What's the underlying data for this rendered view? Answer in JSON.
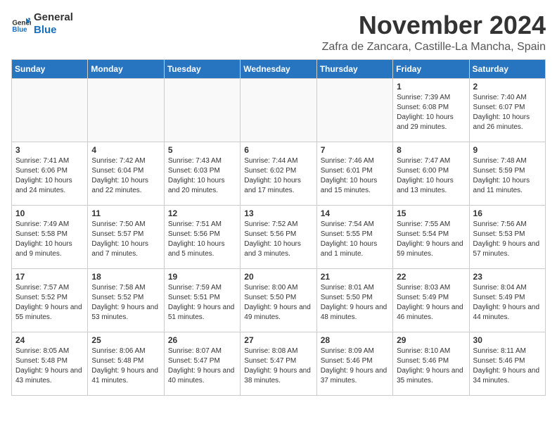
{
  "logo": {
    "line1": "General",
    "line2": "Blue"
  },
  "title": "November 2024",
  "location": "Zafra de Zancara, Castille-La Mancha, Spain",
  "days_of_week": [
    "Sunday",
    "Monday",
    "Tuesday",
    "Wednesday",
    "Thursday",
    "Friday",
    "Saturday"
  ],
  "weeks": [
    [
      {
        "day": "",
        "info": ""
      },
      {
        "day": "",
        "info": ""
      },
      {
        "day": "",
        "info": ""
      },
      {
        "day": "",
        "info": ""
      },
      {
        "day": "",
        "info": ""
      },
      {
        "day": "1",
        "info": "Sunrise: 7:39 AM\nSunset: 6:08 PM\nDaylight: 10 hours and 29 minutes."
      },
      {
        "day": "2",
        "info": "Sunrise: 7:40 AM\nSunset: 6:07 PM\nDaylight: 10 hours and 26 minutes."
      }
    ],
    [
      {
        "day": "3",
        "info": "Sunrise: 7:41 AM\nSunset: 6:06 PM\nDaylight: 10 hours and 24 minutes."
      },
      {
        "day": "4",
        "info": "Sunrise: 7:42 AM\nSunset: 6:04 PM\nDaylight: 10 hours and 22 minutes."
      },
      {
        "day": "5",
        "info": "Sunrise: 7:43 AM\nSunset: 6:03 PM\nDaylight: 10 hours and 20 minutes."
      },
      {
        "day": "6",
        "info": "Sunrise: 7:44 AM\nSunset: 6:02 PM\nDaylight: 10 hours and 17 minutes."
      },
      {
        "day": "7",
        "info": "Sunrise: 7:46 AM\nSunset: 6:01 PM\nDaylight: 10 hours and 15 minutes."
      },
      {
        "day": "8",
        "info": "Sunrise: 7:47 AM\nSunset: 6:00 PM\nDaylight: 10 hours and 13 minutes."
      },
      {
        "day": "9",
        "info": "Sunrise: 7:48 AM\nSunset: 5:59 PM\nDaylight: 10 hours and 11 minutes."
      }
    ],
    [
      {
        "day": "10",
        "info": "Sunrise: 7:49 AM\nSunset: 5:58 PM\nDaylight: 10 hours and 9 minutes."
      },
      {
        "day": "11",
        "info": "Sunrise: 7:50 AM\nSunset: 5:57 PM\nDaylight: 10 hours and 7 minutes."
      },
      {
        "day": "12",
        "info": "Sunrise: 7:51 AM\nSunset: 5:56 PM\nDaylight: 10 hours and 5 minutes."
      },
      {
        "day": "13",
        "info": "Sunrise: 7:52 AM\nSunset: 5:56 PM\nDaylight: 10 hours and 3 minutes."
      },
      {
        "day": "14",
        "info": "Sunrise: 7:54 AM\nSunset: 5:55 PM\nDaylight: 10 hours and 1 minute."
      },
      {
        "day": "15",
        "info": "Sunrise: 7:55 AM\nSunset: 5:54 PM\nDaylight: 9 hours and 59 minutes."
      },
      {
        "day": "16",
        "info": "Sunrise: 7:56 AM\nSunset: 5:53 PM\nDaylight: 9 hours and 57 minutes."
      }
    ],
    [
      {
        "day": "17",
        "info": "Sunrise: 7:57 AM\nSunset: 5:52 PM\nDaylight: 9 hours and 55 minutes."
      },
      {
        "day": "18",
        "info": "Sunrise: 7:58 AM\nSunset: 5:52 PM\nDaylight: 9 hours and 53 minutes."
      },
      {
        "day": "19",
        "info": "Sunrise: 7:59 AM\nSunset: 5:51 PM\nDaylight: 9 hours and 51 minutes."
      },
      {
        "day": "20",
        "info": "Sunrise: 8:00 AM\nSunset: 5:50 PM\nDaylight: 9 hours and 49 minutes."
      },
      {
        "day": "21",
        "info": "Sunrise: 8:01 AM\nSunset: 5:50 PM\nDaylight: 9 hours and 48 minutes."
      },
      {
        "day": "22",
        "info": "Sunrise: 8:03 AM\nSunset: 5:49 PM\nDaylight: 9 hours and 46 minutes."
      },
      {
        "day": "23",
        "info": "Sunrise: 8:04 AM\nSunset: 5:49 PM\nDaylight: 9 hours and 44 minutes."
      }
    ],
    [
      {
        "day": "24",
        "info": "Sunrise: 8:05 AM\nSunset: 5:48 PM\nDaylight: 9 hours and 43 minutes."
      },
      {
        "day": "25",
        "info": "Sunrise: 8:06 AM\nSunset: 5:48 PM\nDaylight: 9 hours and 41 minutes."
      },
      {
        "day": "26",
        "info": "Sunrise: 8:07 AM\nSunset: 5:47 PM\nDaylight: 9 hours and 40 minutes."
      },
      {
        "day": "27",
        "info": "Sunrise: 8:08 AM\nSunset: 5:47 PM\nDaylight: 9 hours and 38 minutes."
      },
      {
        "day": "28",
        "info": "Sunrise: 8:09 AM\nSunset: 5:46 PM\nDaylight: 9 hours and 37 minutes."
      },
      {
        "day": "29",
        "info": "Sunrise: 8:10 AM\nSunset: 5:46 PM\nDaylight: 9 hours and 35 minutes."
      },
      {
        "day": "30",
        "info": "Sunrise: 8:11 AM\nSunset: 5:46 PM\nDaylight: 9 hours and 34 minutes."
      }
    ]
  ]
}
